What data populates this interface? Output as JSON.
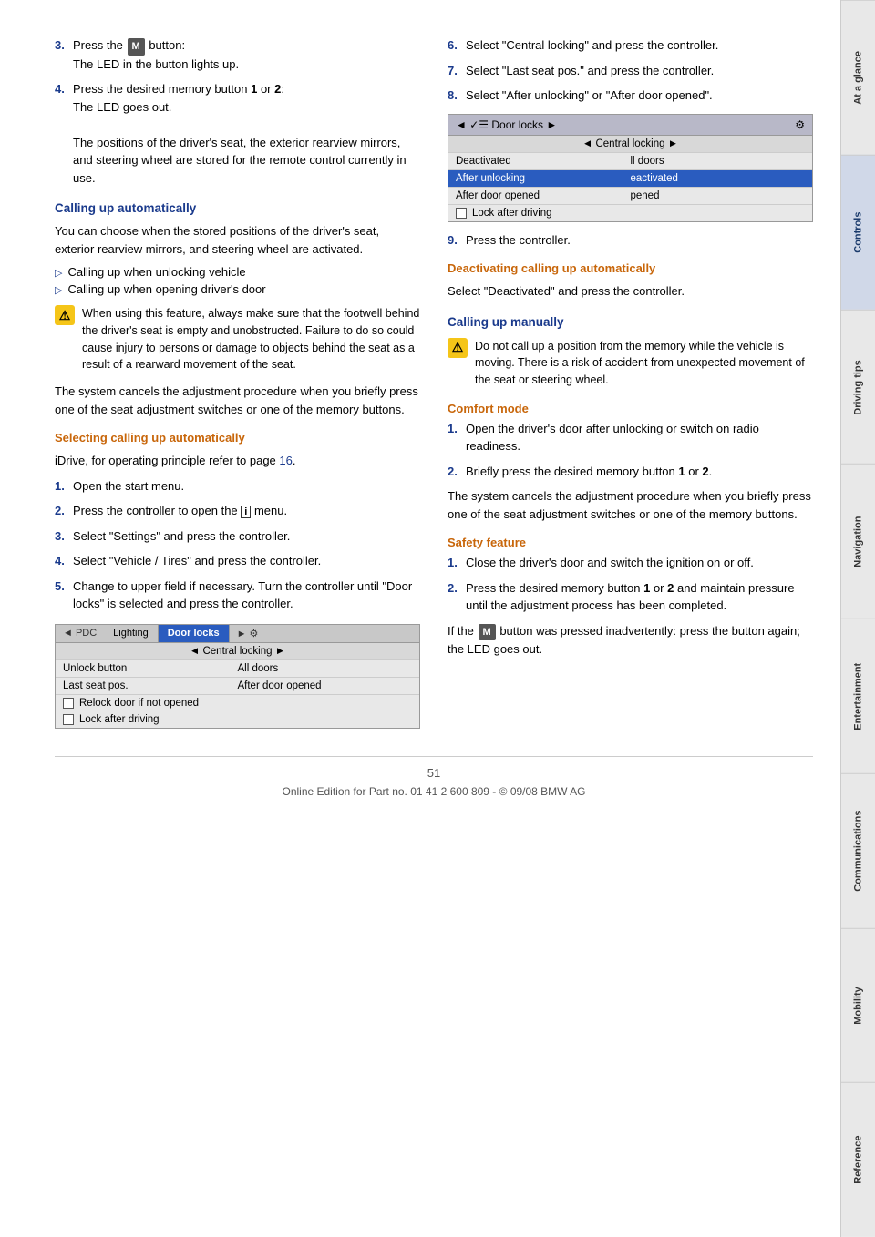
{
  "page": {
    "number": "51",
    "footer_text": "Online Edition for Part no. 01 41 2 600 809 - © 09/08 BMW AG"
  },
  "sidebar": {
    "tabs": [
      {
        "label": "At a glance",
        "active": false
      },
      {
        "label": "Controls",
        "active": true
      },
      {
        "label": "Driving tips",
        "active": false
      },
      {
        "label": "Navigation",
        "active": false
      },
      {
        "label": "Entertainment",
        "active": false
      },
      {
        "label": "Communications",
        "active": false
      },
      {
        "label": "Mobility",
        "active": false
      },
      {
        "label": "Reference",
        "active": false
      }
    ]
  },
  "left_col": {
    "step3": {
      "num": "3.",
      "text": "Press the",
      "btn": "M",
      "text2": "button:",
      "detail": "The LED in the button lights up."
    },
    "step4": {
      "num": "4.",
      "text": "Press the desired memory button",
      "bold1": "1",
      "or": "or",
      "bold2": "2",
      "text2": ":",
      "detail": "The LED goes out.",
      "detail2": "The positions of the driver's seat, the exterior rearview mirrors, and steering wheel are stored for the remote control currently in use."
    },
    "calling_up_auto": {
      "heading": "Calling up automatically",
      "body": "You can choose when the stored positions of the driver's seat, exterior rearview mirrors, and steering wheel are activated.",
      "bullets": [
        "Calling up when unlocking vehicle",
        "Calling up when opening driver's door"
      ],
      "warning": "When using this feature, always make sure that the footwell behind the driver's seat is empty and unobstructed. Failure to do so could cause injury to persons or damage to objects behind the seat as a result of a rearward movement of the seat.",
      "system_note": "The system cancels the adjustment procedure when you briefly press one of the seat adjustment switches or one of the memory buttons."
    },
    "selecting_heading": "Selecting calling up automatically",
    "idrive_ref": "iDrive, for operating principle refer to page 16.",
    "steps": [
      {
        "num": "1.",
        "text": "Open the start menu."
      },
      {
        "num": "2.",
        "text": "Press the controller to open the",
        "icon": "i",
        "text2": "menu."
      },
      {
        "num": "3.",
        "text": "Select \"Settings\" and press the controller."
      },
      {
        "num": "4.",
        "text": "Select \"Vehicle / Tires\" and press the controller."
      },
      {
        "num": "5.",
        "text": "Change to upper field if necessary. Turn the controller until \"Door locks\" is selected and press the controller."
      }
    ],
    "ui_box1": {
      "tab_left": "◄ PDC",
      "tab_mid": "Lighting",
      "tab_right_selected": "Door locks",
      "tab_nav": "►",
      "sub_header": "◄ Central locking ►",
      "rows": [
        {
          "col1": "Unlock button",
          "col2": "All doors",
          "selected": false
        },
        {
          "col1": "Last seat pos.",
          "col2": "After door opened",
          "selected": false
        }
      ],
      "checkbox_rows": [
        {
          "label": "Relock door if not opened",
          "checked": false
        },
        {
          "label": "Lock after driving",
          "checked": false
        }
      ]
    }
  },
  "right_col": {
    "step6": {
      "num": "6.",
      "text": "Select \"Central locking\" and press the controller."
    },
    "step7": {
      "num": "7.",
      "text": "Select \"Last seat pos.\" and press the controller."
    },
    "step8": {
      "num": "8.",
      "text": "Select \"After unlocking\" or \"After door opened\"."
    },
    "ui_box2": {
      "header_left": "◄ ✓☰ Door locks ►",
      "header_icon": "⚙",
      "sub_header": "◄ Central locking ►",
      "rows": [
        {
          "col1": "Deactivated",
          "col2": "ll doors",
          "selected": false
        },
        {
          "col1": "After unlocking",
          "col2": "eactivated",
          "selected": true
        },
        {
          "col1": "After door opened",
          "col2": "pened",
          "selected": false
        }
      ],
      "checkbox_rows": [
        {
          "label": "Lock after driving",
          "checked": false
        }
      ]
    },
    "step9": {
      "num": "9.",
      "text": "Press the controller."
    },
    "deactivating_heading": "Deactivating calling up automatically",
    "deactivating_text": "Select \"Deactivated\" and press the controller.",
    "calling_manually_heading": "Calling up manually",
    "calling_manually_warning": "Do not call up a position from the memory while the vehicle is moving. There is a risk of accident from unexpected movement of the seat or steering wheel.",
    "comfort_mode_heading": "Comfort mode",
    "comfort_steps": [
      {
        "num": "1.",
        "text": "Open the driver's door after unlocking or switch on radio readiness."
      },
      {
        "num": "2.",
        "text": "Briefly press the desired memory button",
        "bold": "1",
        "or": "or",
        "bold2": "2",
        "text2": "."
      }
    ],
    "comfort_note": "The system cancels the adjustment procedure when you briefly press one of the seat adjustment switches or one of the memory buttons.",
    "safety_feature_heading": "Safety feature",
    "safety_steps": [
      {
        "num": "1.",
        "text": "Close the driver's door and switch the ignition on or off."
      },
      {
        "num": "2.",
        "text": "Press the desired memory button",
        "bold": "1",
        "or": "or",
        "bold2": "2",
        "text2": "and maintain pressure until the adjustment process has been completed."
      }
    ],
    "safety_note_pre": "If the",
    "safety_note_btn": "M",
    "safety_note_post": "button was pressed inadvertently: press the button again; the LED goes out."
  }
}
